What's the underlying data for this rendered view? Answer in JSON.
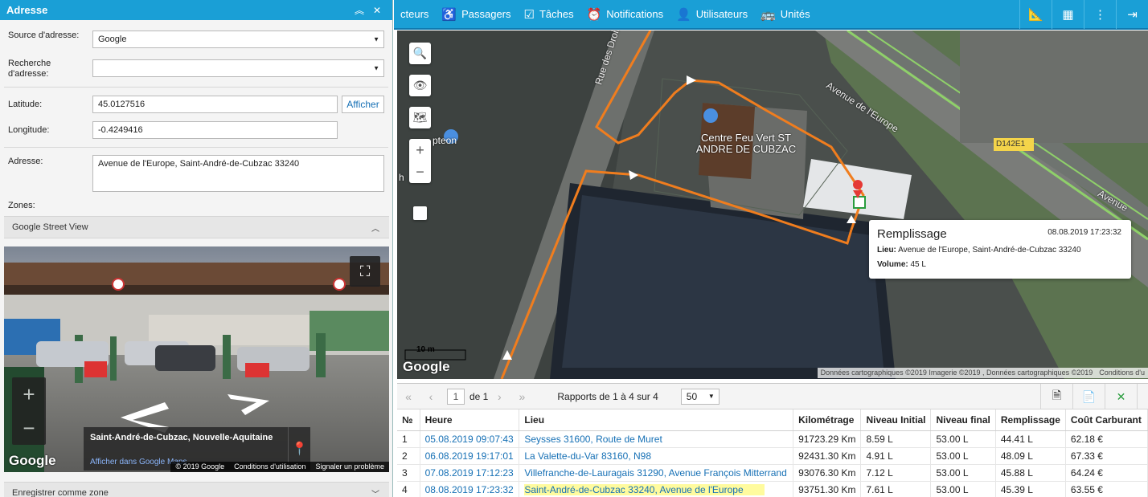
{
  "left_panel": {
    "title": "Adresse",
    "source_label": "Source d'adresse:",
    "source_value": "Google",
    "search_label": "Recherche d'adresse:",
    "search_value": "",
    "latitude_label": "Latitude:",
    "latitude_value": "45.0127516",
    "show_button": "Afficher",
    "longitude_label": "Longitude:",
    "longitude_value": "-0.4249416",
    "address_label": "Adresse:",
    "address_value": "Avenue de l'Europe, Saint-André-de-Cubzac 33240",
    "zones_label": "Zones:",
    "street_view_section": "Google Street View",
    "save_zone_section": "Enregistrer comme zone"
  },
  "street_view": {
    "location": "Saint-André-de-Cubzac, Nouvelle-Aquitaine",
    "open_in_maps": "Afficher dans Google Maps",
    "logo": "Google",
    "copyright": "© 2019 Google",
    "terms": "Conditions d'utilisation",
    "report": "Signaler un problème"
  },
  "nav": {
    "items": [
      {
        "label": "cteurs",
        "icon": ""
      },
      {
        "label": "Passagers",
        "icon": "passenger-icon"
      },
      {
        "label": "Tâches",
        "icon": "tasks-icon"
      },
      {
        "label": "Notifications",
        "icon": "alarm-icon"
      },
      {
        "label": "Utilisateurs",
        "icon": "user-icon"
      },
      {
        "label": "Unités",
        "icon": "bus-icon"
      }
    ]
  },
  "map": {
    "labels": {
      "poi": "Centre Feu Vert ST ANDRE DE CUBZAC",
      "road_1": "Avenue de l'Europe",
      "road_2": "Rue des Droits de l'Homme",
      "road_3": "Avenue",
      "badge": "D142E1",
      "partial_1": "pteon",
      "partial_2": "h",
      "scale": "10 m"
    },
    "logo": "Google",
    "attribution": "Données cartographiques ©2019 Imagerie ©2019 , Données cartographiques ©2019",
    "conditions": "Conditions d'u",
    "popup": {
      "title": "Remplissage",
      "date": "08.08.2019 17:23:32",
      "lieu_label": "Lieu:",
      "lieu_value": "Avenue de l'Europe, Saint-André-de-Cubzac 33240",
      "volume_label": "Volume:",
      "volume_value": "45 L"
    }
  },
  "pager": {
    "page": "1",
    "of": "de 1",
    "reports": "Rapports de 1 à 4 sur 4",
    "per_page": "50"
  },
  "table": {
    "headers": [
      "№",
      "Heure",
      "Lieu",
      "Kilométrage",
      "Niveau Initial",
      "Niveau final",
      "Remplissage",
      "Coût Carburant"
    ],
    "rows": [
      {
        "n": "1",
        "heure": "05.08.2019 09:07:43",
        "lieu": "Seysses 31600, Route de Muret",
        "km": "91723.29 Km",
        "ini": "8.59 L",
        "fin": "53.00 L",
        "rem": "44.41 L",
        "cout": "62.18 €"
      },
      {
        "n": "2",
        "heure": "06.08.2019 19:17:01",
        "lieu": "La Valette-du-Var 83160, N98",
        "km": "92431.30 Km",
        "ini": "4.91 L",
        "fin": "53.00 L",
        "rem": "48.09 L",
        "cout": "67.33 €"
      },
      {
        "n": "3",
        "heure": "07.08.2019 17:12:23",
        "lieu": "Villefranche-de-Lauragais 31290, Avenue François Mitterrand",
        "km": "93076.30 Km",
        "ini": "7.12 L",
        "fin": "53.00 L",
        "rem": "45.88 L",
        "cout": "64.24 €"
      },
      {
        "n": "4",
        "heure": "08.08.2019 17:23:32",
        "lieu": "Saint-André-de-Cubzac 33240, Avenue de l'Europe",
        "km": "93751.30 Km",
        "ini": "7.61 L",
        "fin": "53.00 L",
        "rem": "45.39 L",
        "cout": "63.55 €"
      }
    ]
  }
}
